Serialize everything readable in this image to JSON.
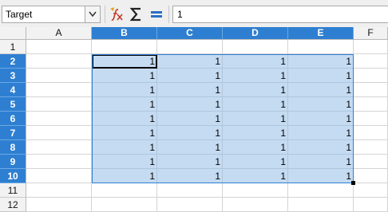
{
  "formula_bar": {
    "name_box_value": "Target",
    "formula_value": "1",
    "icons": {
      "dropdown": "chevron-down-icon",
      "function_wizard": "function-wizard-icon",
      "sum": "sigma-icon",
      "equals": "equals-icon"
    }
  },
  "sheet": {
    "columns": [
      "A",
      "B",
      "C",
      "D",
      "E",
      "F"
    ],
    "selected_columns": [
      "B",
      "C",
      "D",
      "E"
    ],
    "rows": [
      "1",
      "2",
      "3",
      "4",
      "5",
      "6",
      "7",
      "8",
      "9",
      "10",
      "11",
      "12"
    ],
    "selected_rows": [
      "2",
      "3",
      "4",
      "5",
      "6",
      "7",
      "8",
      "9",
      "10"
    ],
    "current_cell": "B2",
    "cells": {
      "B2": "1",
      "C2": "1",
      "D2": "1",
      "E2": "1",
      "B3": "1",
      "C3": "1",
      "D3": "1",
      "E3": "1",
      "B4": "1",
      "C4": "1",
      "D4": "1",
      "E4": "1",
      "B5": "1",
      "C5": "1",
      "D5": "1",
      "E5": "1",
      "B6": "1",
      "C6": "1",
      "D6": "1",
      "E6": "1",
      "B7": "1",
      "C7": "1",
      "D7": "1",
      "E7": "1",
      "B8": "1",
      "C8": "1",
      "D8": "1",
      "E8": "1",
      "B9": "1",
      "C9": "1",
      "D9": "1",
      "E9": "1",
      "B10": "1",
      "C10": "1",
      "D10": "1",
      "E10": "1"
    },
    "colors": {
      "header_selected": "#2e7fd1",
      "selection_fill": "#c5dbf2"
    }
  }
}
